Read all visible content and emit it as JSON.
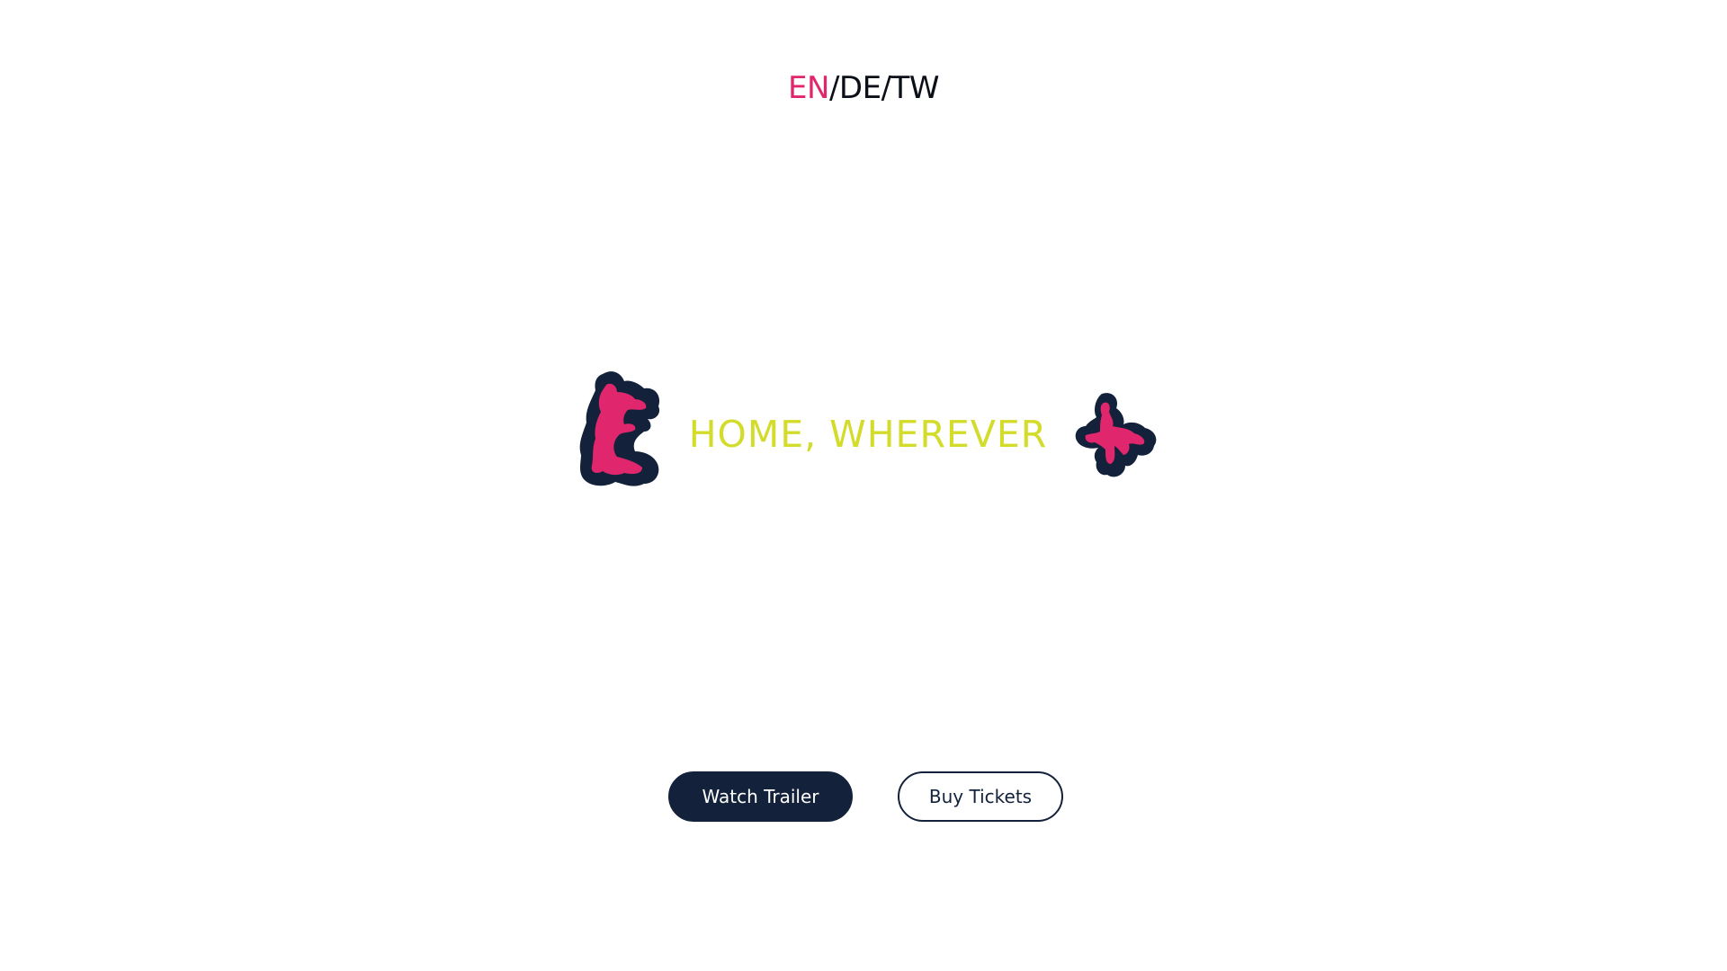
{
  "lang_switch": {
    "items": [
      {
        "label": "EN",
        "active": true
      },
      {
        "label": "DE",
        "active": false
      },
      {
        "label": "TW",
        "active": false
      }
    ],
    "separator": "/"
  },
  "hero": {
    "title": "HOME, WHEREVER",
    "left_figure_icon": "pink-figure-crouching-icon",
    "right_figure_icon": "pink-figure-jumping-icon"
  },
  "actions": {
    "watch_trailer_label": "Watch Trailer",
    "buy_tickets_label": "Buy Tickets"
  },
  "colors": {
    "accent_pink": "#e0276d",
    "title_lime": "#d3dc2a",
    "navy": "#13223a",
    "background": "#ffffff"
  }
}
